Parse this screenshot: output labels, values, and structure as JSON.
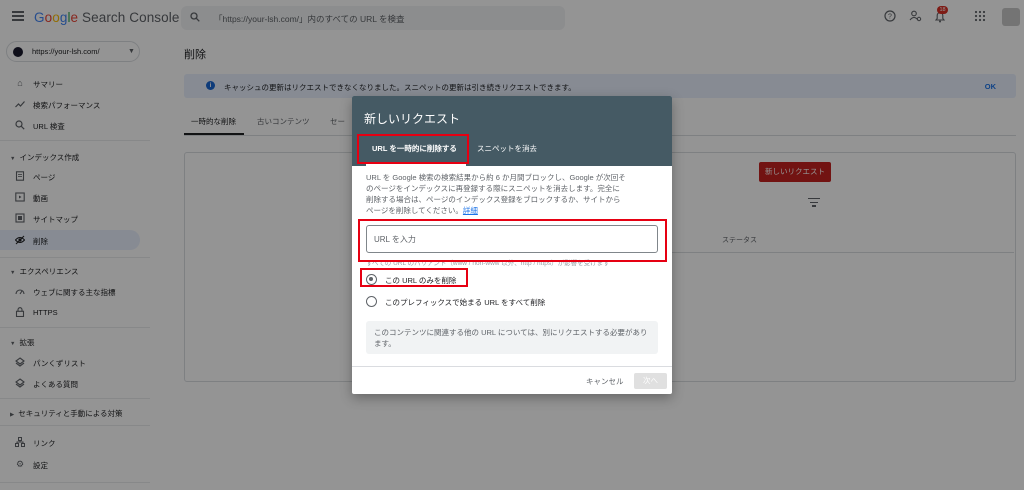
{
  "app": {
    "logo_google": "Google",
    "logo_rest": "Search Console",
    "search_placeholder": "「https://your-lsh.com/」内のすべての URL を検査",
    "notifications_count": "18"
  },
  "property": {
    "label": "https://your-lsh.com/"
  },
  "sidebar": {
    "items": [
      {
        "label": "サマリー",
        "icon": "home-icon"
      },
      {
        "label": "検索パフォーマンス",
        "icon": "trending-up-icon"
      },
      {
        "label": "URL 検査",
        "icon": "search-icon"
      }
    ],
    "index_section": {
      "title": "インデックス作成",
      "items": [
        {
          "label": "ページ",
          "icon": "page-icon"
        },
        {
          "label": "動画",
          "icon": "video-icon"
        },
        {
          "label": "サイトマップ",
          "icon": "sitemap-icon"
        },
        {
          "label": "削除",
          "icon": "removal-icon"
        }
      ]
    },
    "experience_section": {
      "title": "エクスペリエンス",
      "items": [
        {
          "label": "ウェブに関する主な指標",
          "icon": "speed-icon"
        },
        {
          "label": "HTTPS",
          "icon": "lock-icon"
        }
      ]
    },
    "enhancements_section": {
      "title": "拡張",
      "items": [
        {
          "label": "パンくずリスト",
          "icon": "layers-icon"
        },
        {
          "label": "よくある質問",
          "icon": "layers-icon"
        }
      ]
    },
    "security_section": {
      "title": "セキュリティと手動による対策"
    },
    "bottom_items": [
      {
        "label": "リンク",
        "icon": "links-icon"
      },
      {
        "label": "設定",
        "icon": "settings-icon"
      }
    ]
  },
  "main": {
    "title": "削除",
    "banner_text": "キャッシュの更新はリクエストできなくなりました。スニペットの更新は引き続きリクエストできます。",
    "banner_ok": "OK",
    "tabs": [
      "一時的な削除",
      "古いコンテンツ",
      "セー"
    ],
    "new_request_button": "新しいリクエスト",
    "status_column": "ステータス"
  },
  "dialog": {
    "title": "新しいリクエスト",
    "tab_remove": "URL を一時的に削除する",
    "tab_snippet": "スニペットを消去",
    "description_lines": [
      "URL を Google 検索の検索結果から約 6 か月間ブロックし、Google が次回そ",
      "のページをインデックスに再登録する際にスニペットを消去します。完全に",
      "削除する場合は、ページのインデックス登録をブロックするか、サイトから",
      "ページを削除してください。"
    ],
    "details_link": "詳細",
    "url_placeholder": "URL を入力",
    "hint": "すべての URL のバリアント（www / non-www 以外、http / https）が影響を受けます",
    "radio_this_url": "この URL のみを削除",
    "radio_prefix": "このプレフィックスで始まる URL をすべて削除",
    "note": "このコンテンツに関連する他の URL については、別にリクエストする必要があります。",
    "cancel": "キャンセル",
    "next": "次へ"
  }
}
